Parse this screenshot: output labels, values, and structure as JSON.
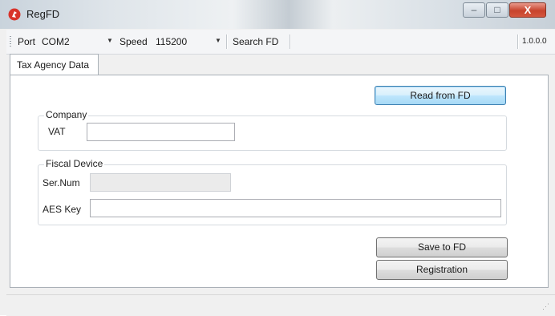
{
  "window": {
    "title": "RegFD",
    "minimize_glyph": "–",
    "maximize_glyph": "□",
    "close_glyph": "X"
  },
  "toolbar": {
    "port_label": "Port",
    "port_value": "COM2",
    "speed_label": "Speed",
    "speed_value": "115200",
    "dropdown_arrow": "▼",
    "search_label": "Search FD",
    "version": "1.0.0.0"
  },
  "tabs": [
    {
      "label": "Tax Agency Data"
    }
  ],
  "main": {
    "read_button": "Read from FD",
    "company_group": {
      "title": "Company",
      "vat_label": "VAT",
      "vat_value": ""
    },
    "device_group": {
      "title": "Fiscal Device",
      "sernum_label": "Ser.Num",
      "sernum_value": "",
      "aeskey_label": "AES Key",
      "aeskey_value": ""
    },
    "save_button": "Save to FD",
    "registration_button": "Registration"
  },
  "colors": {
    "close_button": "#c7432c",
    "focused_button_border": "#3c7fb1"
  }
}
